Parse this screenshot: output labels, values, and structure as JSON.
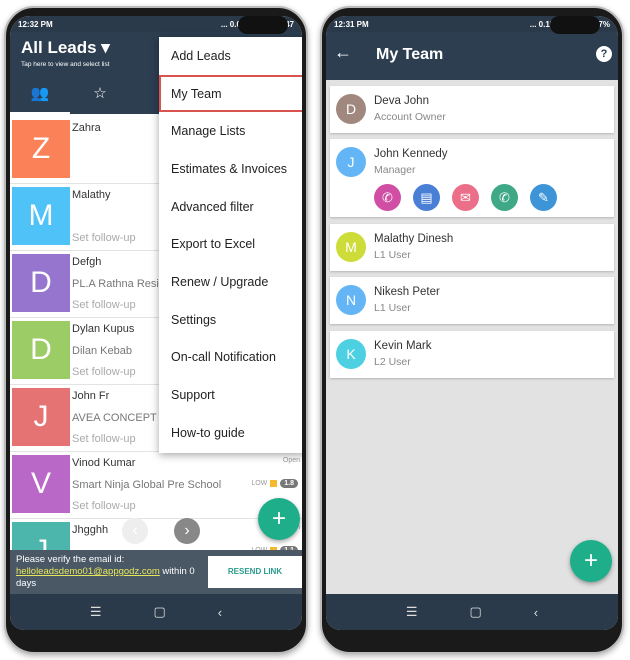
{
  "left": {
    "status": {
      "time": "12:32 PM",
      "right": "... 0.00K/s ⏰ 4G 47"
    },
    "header": {
      "title": "All Leads ▾",
      "subtitle": "Tap here to view and select list"
    },
    "tabs": [
      {
        "icon": "team-icon",
        "glyph": "👥"
      },
      {
        "icon": "star-icon",
        "glyph": "☆"
      }
    ],
    "leads": [
      {
        "initial": "Z",
        "name": "Zahra",
        "company": "",
        "followup": "",
        "color": "#fb8159"
      },
      {
        "initial": "M",
        "name": "Malathy",
        "company": "",
        "followup": "Set follow-up",
        "color": "#4fc3f7"
      },
      {
        "initial": "D",
        "name": "Defgh",
        "company": "PL.A Rathna Resi",
        "followup": "Set follow-up",
        "color": "#9575cd"
      },
      {
        "initial": "D",
        "name": "Dylan Kupus",
        "company": "Dilan Kebab",
        "followup": "Set follow-up",
        "color": "#9ccc65"
      },
      {
        "initial": "J",
        "name": "John Fr",
        "company": "AVEA CONCEPT",
        "followup": "Set follow-up",
        "color": "#e57373"
      },
      {
        "initial": "V",
        "name": "Vinod Kumar",
        "company": "Smart Ninja Global Pre School",
        "followup": "Set follow-up",
        "color": "#ba68c8",
        "status": "Open",
        "priority": "LOW",
        "score": "1.8"
      },
      {
        "initial": "J",
        "name": "Jhgghh",
        "company": "",
        "followup": "",
        "color": "#4db6ac",
        "status": "Open",
        "priority": "LOW",
        "score": "1.1"
      }
    ],
    "menu": [
      "Add Leads",
      "My Team",
      "Manage Lists",
      "Estimates & Invoices",
      "Advanced filter",
      "Export to Excel",
      "Renew / Upgrade",
      "Settings",
      "On-call Notification",
      "Support",
      "How-to guide"
    ],
    "menu_selected": "My Team",
    "banner": {
      "text": "Please verify the email id:",
      "email": "helloleadsdemo01@appgodz.com",
      "suffix": " within 0 days",
      "button": "RESEND LINK"
    },
    "fab": "+",
    "nav": [
      "☰",
      "▢",
      "‹"
    ]
  },
  "right": {
    "status": {
      "time": "12:31 PM",
      "right": "... 0.15K/s ⏰ 4G 47%"
    },
    "header": {
      "back": "←",
      "title": "My Team",
      "help": "?"
    },
    "members": [
      {
        "initial": "D",
        "name": "Deva John",
        "role": "Account Owner",
        "color": "#a1887f"
      },
      {
        "initial": "J",
        "name": "John Kennedy",
        "role": "Manager",
        "color": "#64b5f6"
      },
      {
        "initial": "M",
        "name": "Malathy Dinesh",
        "role": "L1 User",
        "color": "#cddc39"
      },
      {
        "initial": "N",
        "name": "Nikesh Peter",
        "role": "L1 User",
        "color": "#64b5f6"
      },
      {
        "initial": "K",
        "name": "Kevin Mark",
        "role": "L2 User",
        "color": "#4dd0e1"
      }
    ],
    "actions": [
      {
        "icon": "phone-icon",
        "glyph": "✆",
        "color": "#d04fa5"
      },
      {
        "icon": "message-icon",
        "glyph": "▤",
        "color": "#4a7fd6"
      },
      {
        "icon": "email-icon",
        "glyph": "✉",
        "color": "#ec6f8a"
      },
      {
        "icon": "whatsapp-icon",
        "glyph": "✆",
        "color": "#3fa987"
      },
      {
        "icon": "edit-icon",
        "glyph": "✎",
        "color": "#3d95d8"
      }
    ],
    "fab": "+",
    "nav": [
      "☰",
      "▢",
      "‹"
    ]
  }
}
